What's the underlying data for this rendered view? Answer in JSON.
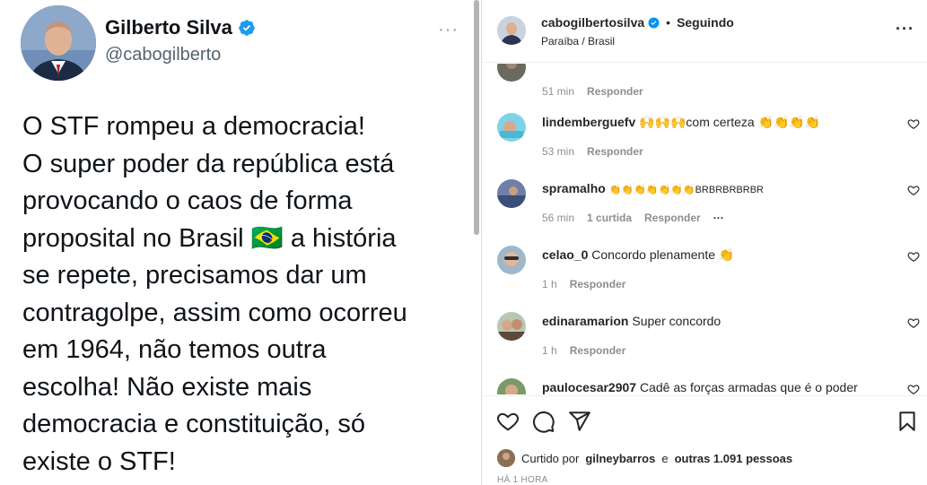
{
  "tweet": {
    "name": "Gilberto Silva",
    "handle": "@cabogilberto",
    "more": "···",
    "lines": [
      "O STF rompeu a democracia!",
      "O super poder da república está",
      "provocando o caos de forma",
      "proposital no Brasil 🇧🇷 a história",
      "se repete, precisamos dar um",
      "contragolpe, assim como ocorreu",
      "em 1964, não temos outra",
      "escolha! Não existe mais",
      "democracia e constituição, só",
      "existe o STF!"
    ]
  },
  "instagram": {
    "header": {
      "username": "cabogilbertosilva",
      "dot": "•",
      "follow_status": "Seguindo",
      "location": "Paraíba / Brasil",
      "more": "···"
    },
    "comments": [
      {
        "user": "",
        "text": "",
        "time": "51 min",
        "reply": "Responder",
        "likes": "",
        "more": ""
      },
      {
        "user": "lindemberguefv",
        "text": "🙌🙌🙌com certeza 👏👏👏👏",
        "time": "53 min",
        "reply": "Responder",
        "likes": "",
        "more": ""
      },
      {
        "user": "spramalho",
        "text": "👏👏👏👏👏👏👏BRBRBRBRBR",
        "time": "56 min",
        "reply": "Responder",
        "likes": "1 curtida",
        "more": "···"
      },
      {
        "user": "celao_0",
        "text": "Concordo plenamente 👏",
        "time": "1 h",
        "reply": "Responder",
        "likes": "",
        "more": ""
      },
      {
        "user": "edinaramarion",
        "text": "Super concordo",
        "time": "1 h",
        "reply": "Responder",
        "likes": "",
        "more": ""
      },
      {
        "user": "paulocesar2907",
        "text": "Cadê as forças armadas que é o poder",
        "time": "",
        "reply": "",
        "likes": "",
        "more": ""
      }
    ],
    "liked_prefix": "Curtido por",
    "liked_user": "gilneybarros",
    "liked_and": "e",
    "liked_others": "outras 1.091 pessoas",
    "time_ago": "HÁ 1 HORA"
  },
  "colors": {
    "verified": "#1d9bf0",
    "ig_verified": "#0095f6",
    "text_dark": "#0f1419",
    "muted": "#8e8e8e"
  }
}
